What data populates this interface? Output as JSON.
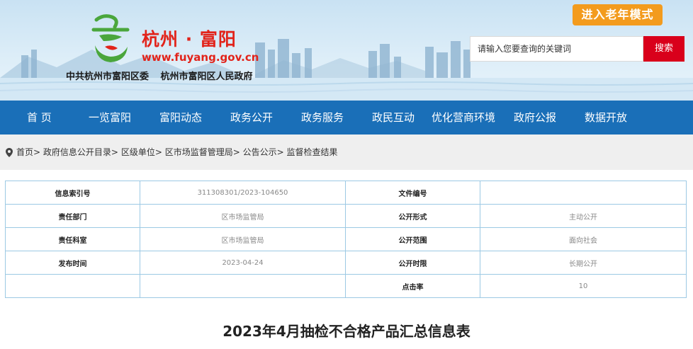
{
  "header": {
    "site_name": "杭州 · 富阳",
    "site_url": "www.fuyang.gov.cn",
    "org_names": [
      "中共杭州市富阳区委",
      "杭州市富阳区人民政府"
    ],
    "elder_mode_label": "进入老年模式",
    "search_placeholder": "请输入您要查询的关键词",
    "search_label": "搜索"
  },
  "nav": {
    "items": [
      {
        "label": "首 页"
      },
      {
        "label": "一览富阳"
      },
      {
        "label": "富阳动态"
      },
      {
        "label": "政务公开"
      },
      {
        "label": "政务服务"
      },
      {
        "label": "政民互动"
      },
      {
        "label": "优化营商环境"
      },
      {
        "label": "政府公报"
      },
      {
        "label": "数据开放"
      }
    ]
  },
  "breadcrumb": {
    "items": [
      "首页",
      "政府信息公开目录",
      "区级单位",
      "区市场监督管理局",
      "公告公示",
      "监督检查结果"
    ],
    "separator": ">"
  },
  "info_table": {
    "rows": [
      {
        "k1": "信息索引号",
        "v1": "311308301/2023-104650",
        "k2": "文件编号",
        "v2": ""
      },
      {
        "k1": "责任部门",
        "v1": "区市场监管局",
        "k2": "公开形式",
        "v2": "主动公开"
      },
      {
        "k1": "责任科室",
        "v1": "区市场监管局",
        "k2": "公开范围",
        "v2": "面向社会"
      },
      {
        "k1": "发布时间",
        "v1": "2023-04-24",
        "k2": "公开时限",
        "v2": "长期公开"
      },
      {
        "k1": "",
        "v1": "",
        "k2": "点击率",
        "v2": "10"
      }
    ]
  },
  "document": {
    "title": "2023年4月抽检不合格产品汇总信息表"
  },
  "colors": {
    "brand_red": "#e2231a",
    "nav_blue": "#1a6fb8",
    "elder_orange": "#f39b1d",
    "search_red": "#d9001b",
    "table_border": "#9cc9e4"
  }
}
